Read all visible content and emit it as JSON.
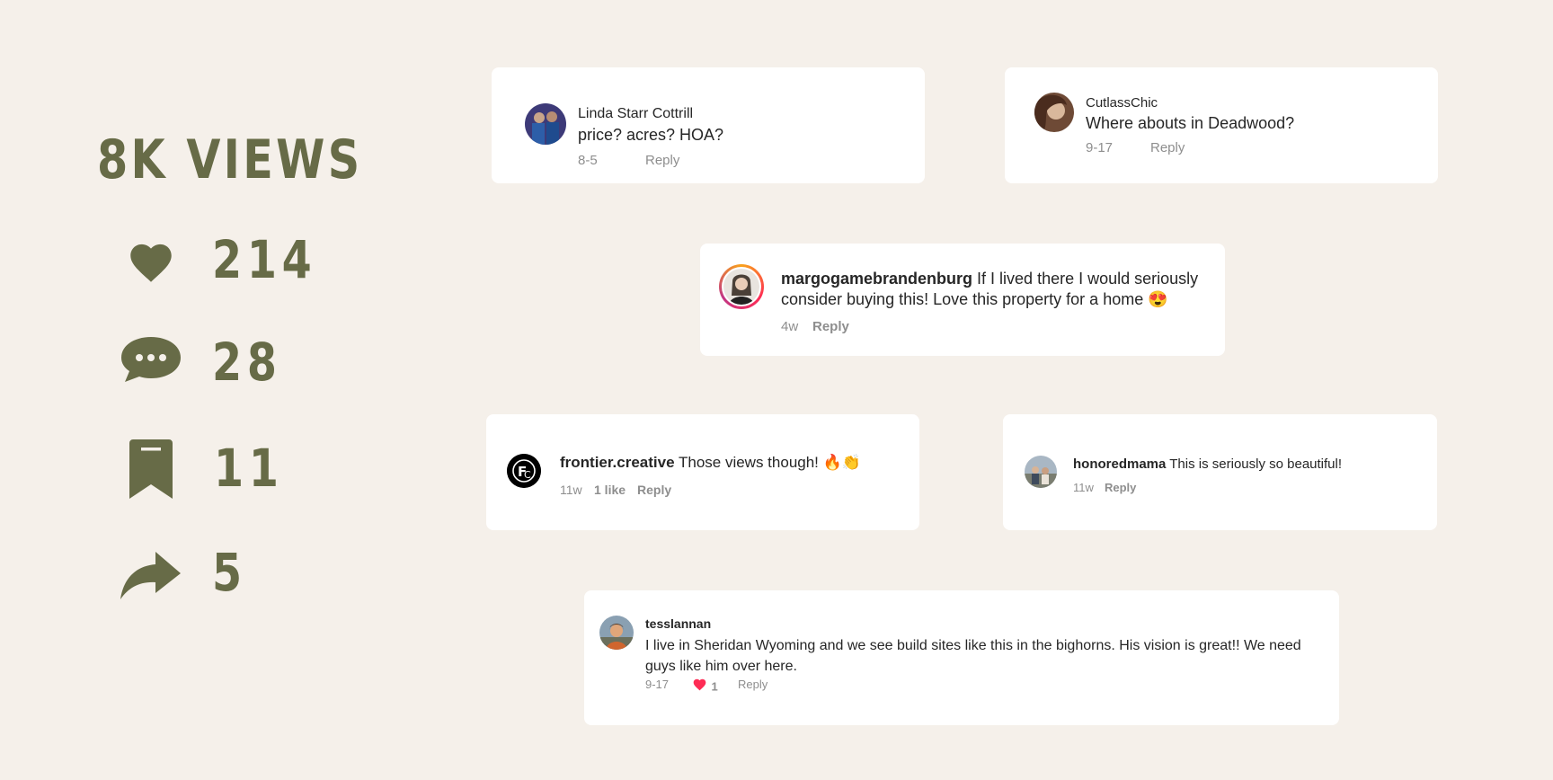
{
  "stats": {
    "views": "8K VIEWS",
    "likes": "214",
    "comments": "28",
    "saves": "11",
    "shares": "5",
    "color": "#676b47"
  },
  "comments": [
    {
      "username": "Linda Starr Cottrill",
      "text": "price? acres? HOA?",
      "time": "8-5",
      "reply": "Reply"
    },
    {
      "username": "CutlassChic",
      "text": "Where abouts in Deadwood?",
      "time": "9-17",
      "reply": "Reply"
    },
    {
      "username": "margogamebrandenburg",
      "text": "If I lived there I would seriously consider buying this! Love this property for a home 😍",
      "time": "4w",
      "reply": "Reply"
    },
    {
      "username": "frontier.creative",
      "text": "Those views though! 🔥👏",
      "time": "11w",
      "likes": "1 like",
      "reply": "Reply"
    },
    {
      "username": "honoredmama",
      "text": "This is seriously so beautiful!",
      "time": "11w",
      "reply": "Reply"
    },
    {
      "username": "tesslannan",
      "text": "I live in Sheridan Wyoming and we see build sites like this in the bighorns. His vision is great!! We need guys like him over here.",
      "time": "9-17",
      "likes": "1",
      "reply": "Reply"
    }
  ],
  "colors": {
    "background": "#f5f0ea",
    "card": "#ffffff",
    "heart_red": "#fe2c55",
    "muted": "#8e8e8e"
  }
}
